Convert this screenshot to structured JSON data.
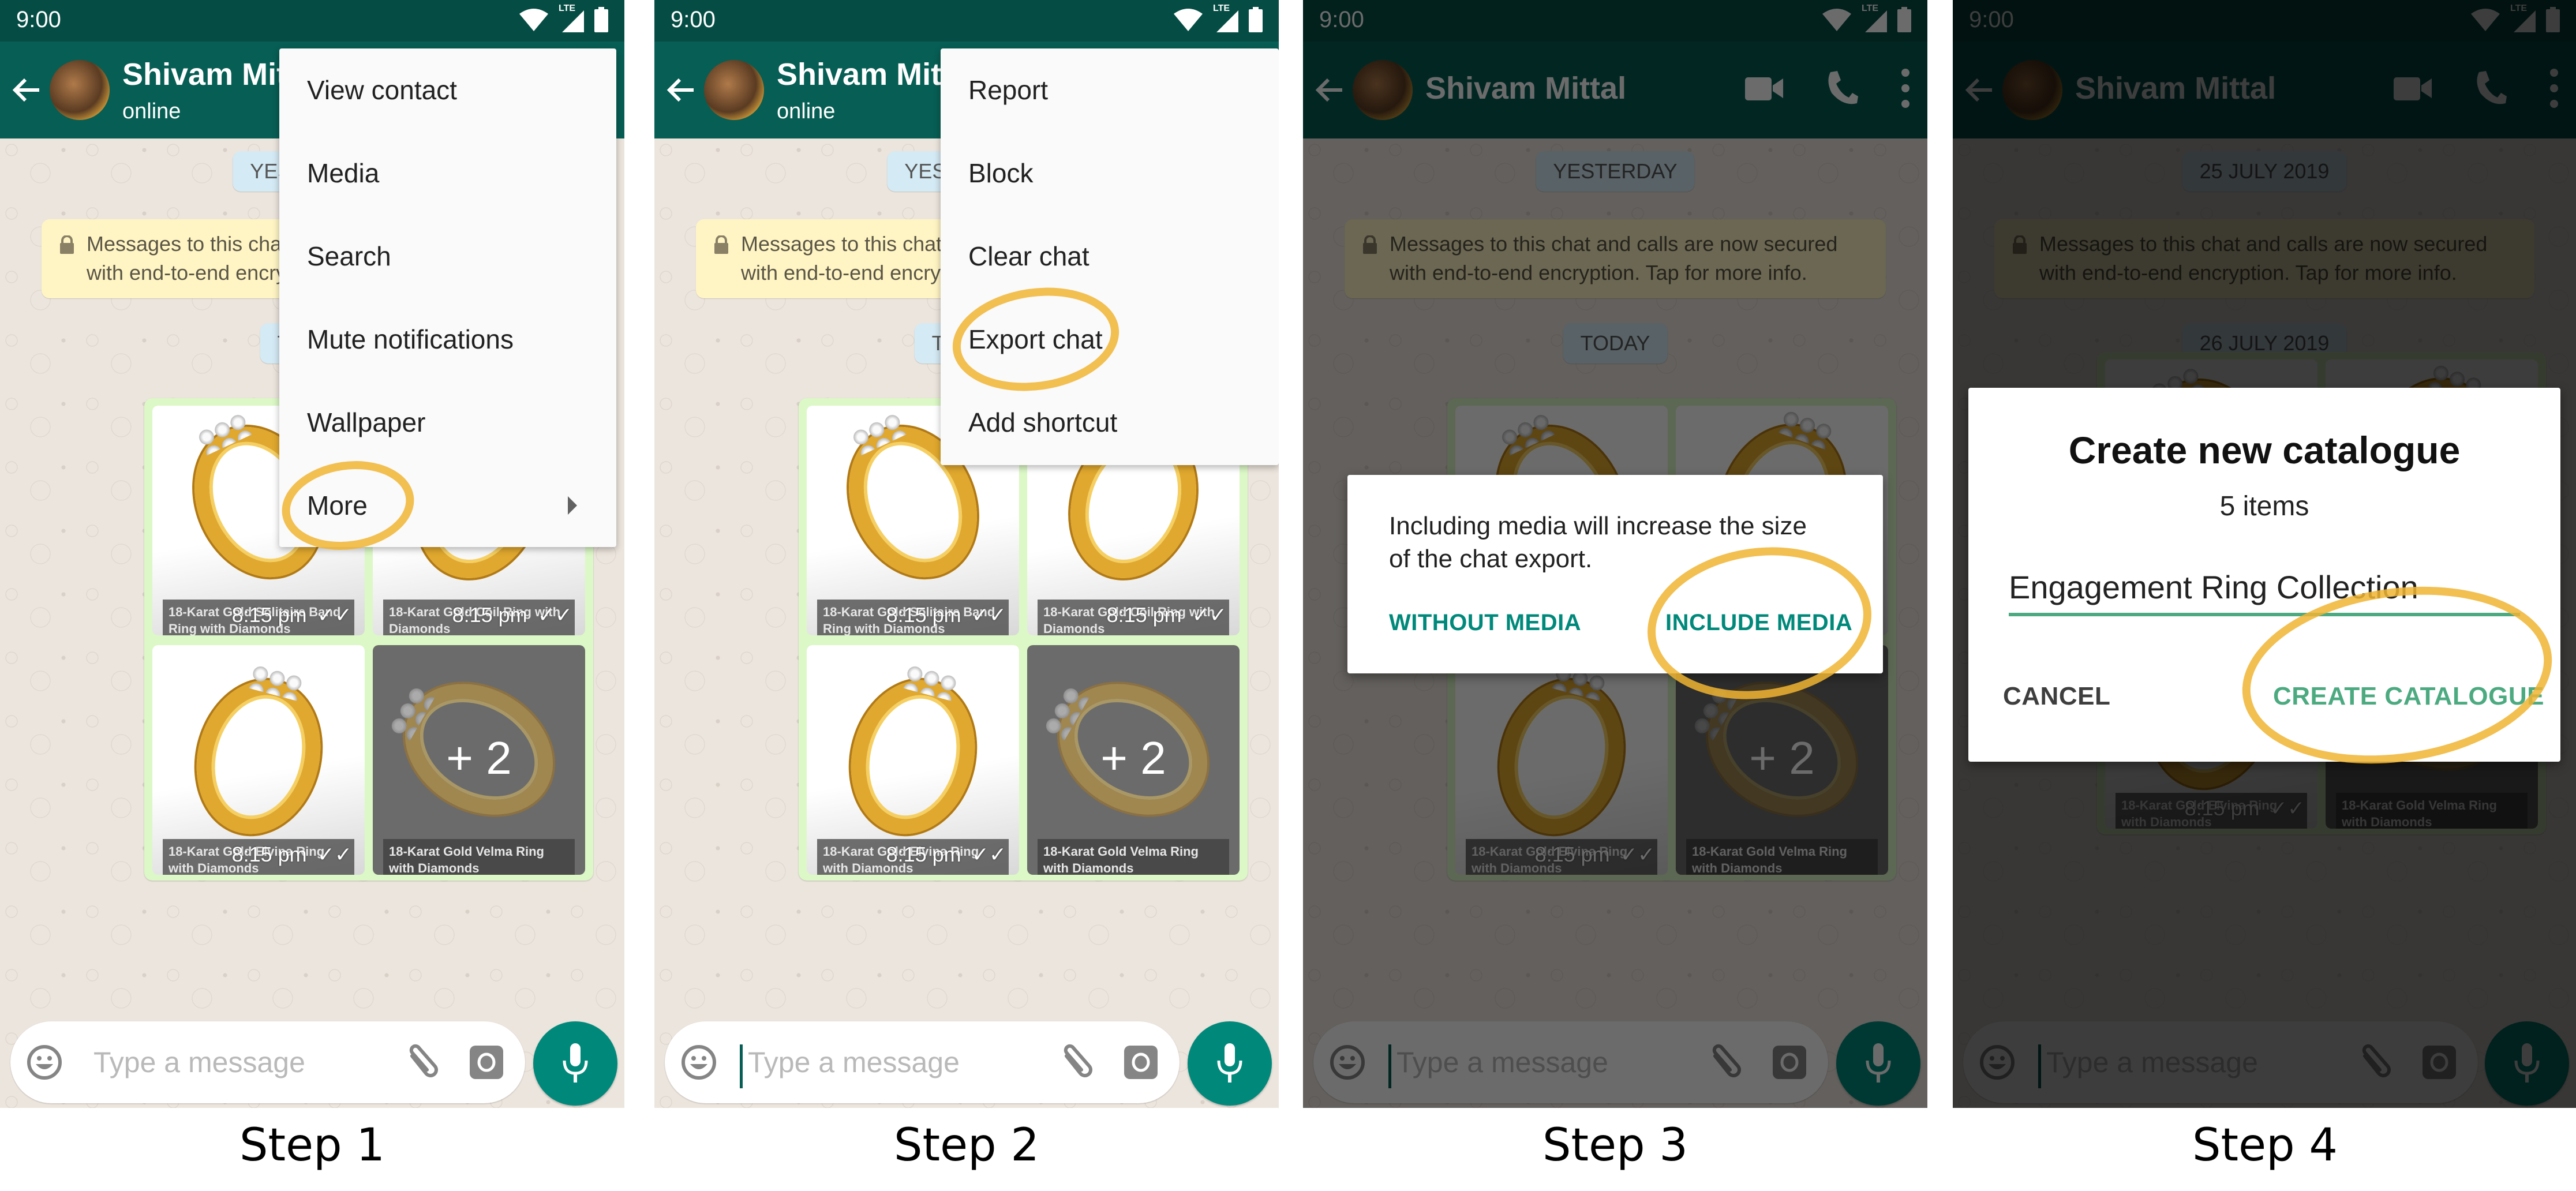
{
  "common": {
    "time": "9:00",
    "network_label": "LTE",
    "contact_name": "Shivam Mittal",
    "contact_status": "online",
    "encryption_notice": "Messages to this chat and calls are now secured with end-to-end encryption. Tap for more info.",
    "composer_placeholder": "Type a message",
    "media_grid": [
      {
        "caption": "18-Karat Gold Solitaire Band Ring with Diamonds",
        "time": "8:15 pm",
        "status": "read"
      },
      {
        "caption": "18-Karat Gold Coil Ring with Diamonds",
        "time": "8:15 pm",
        "status": "read"
      },
      {
        "caption": "18-Karat Gold Elvina Ring with Diamonds",
        "time": "8:15 pm",
        "status": "read"
      },
      {
        "caption": "18-Karat Gold Velma Ring with Diamonds",
        "more_count": "+ 2"
      }
    ],
    "colors": {
      "header": "#075e54",
      "statusbar": "#054d44",
      "accent": "#00897b",
      "highlight": "#f0b432",
      "bubble": "#dcf8c6"
    }
  },
  "steps": [
    {
      "label": "Step 1",
      "date_chips": [
        "YESTERDAY",
        "TODAY"
      ],
      "menu": [
        {
          "label": "View contact"
        },
        {
          "label": "Media"
        },
        {
          "label": "Search"
        },
        {
          "label": "Mute notifications"
        },
        {
          "label": "Wallpaper"
        },
        {
          "label": "More",
          "has_submenu": true,
          "highlighted": true
        }
      ]
    },
    {
      "label": "Step 2",
      "date_chips": [
        "YESTERDAY",
        "TODAY"
      ],
      "menu": [
        {
          "label": "Report"
        },
        {
          "label": "Block"
        },
        {
          "label": "Clear chat"
        },
        {
          "label": "Export chat",
          "highlighted": true
        },
        {
          "label": "Add shortcut"
        }
      ]
    },
    {
      "label": "Step 3",
      "date_chips": [
        "YESTERDAY",
        "TODAY"
      ],
      "dialog": {
        "message": "Including media will increase the size of the chat export.",
        "secondary_button": "WITHOUT MEDIA",
        "primary_button": "INCLUDE MEDIA",
        "highlighted": "INCLUDE MEDIA"
      }
    },
    {
      "label": "Step 4",
      "date_chips": [
        "25 JULY 2019",
        "26 JULY 2019"
      ],
      "dialog": {
        "title": "Create new catalogue",
        "subtitle": "5 items",
        "input_value": "Engagement Ring Collection",
        "cancel_button": "CANCEL",
        "confirm_button": "CREATE CATALOGUE",
        "highlighted": "CREATE CATALOGUE"
      }
    }
  ]
}
